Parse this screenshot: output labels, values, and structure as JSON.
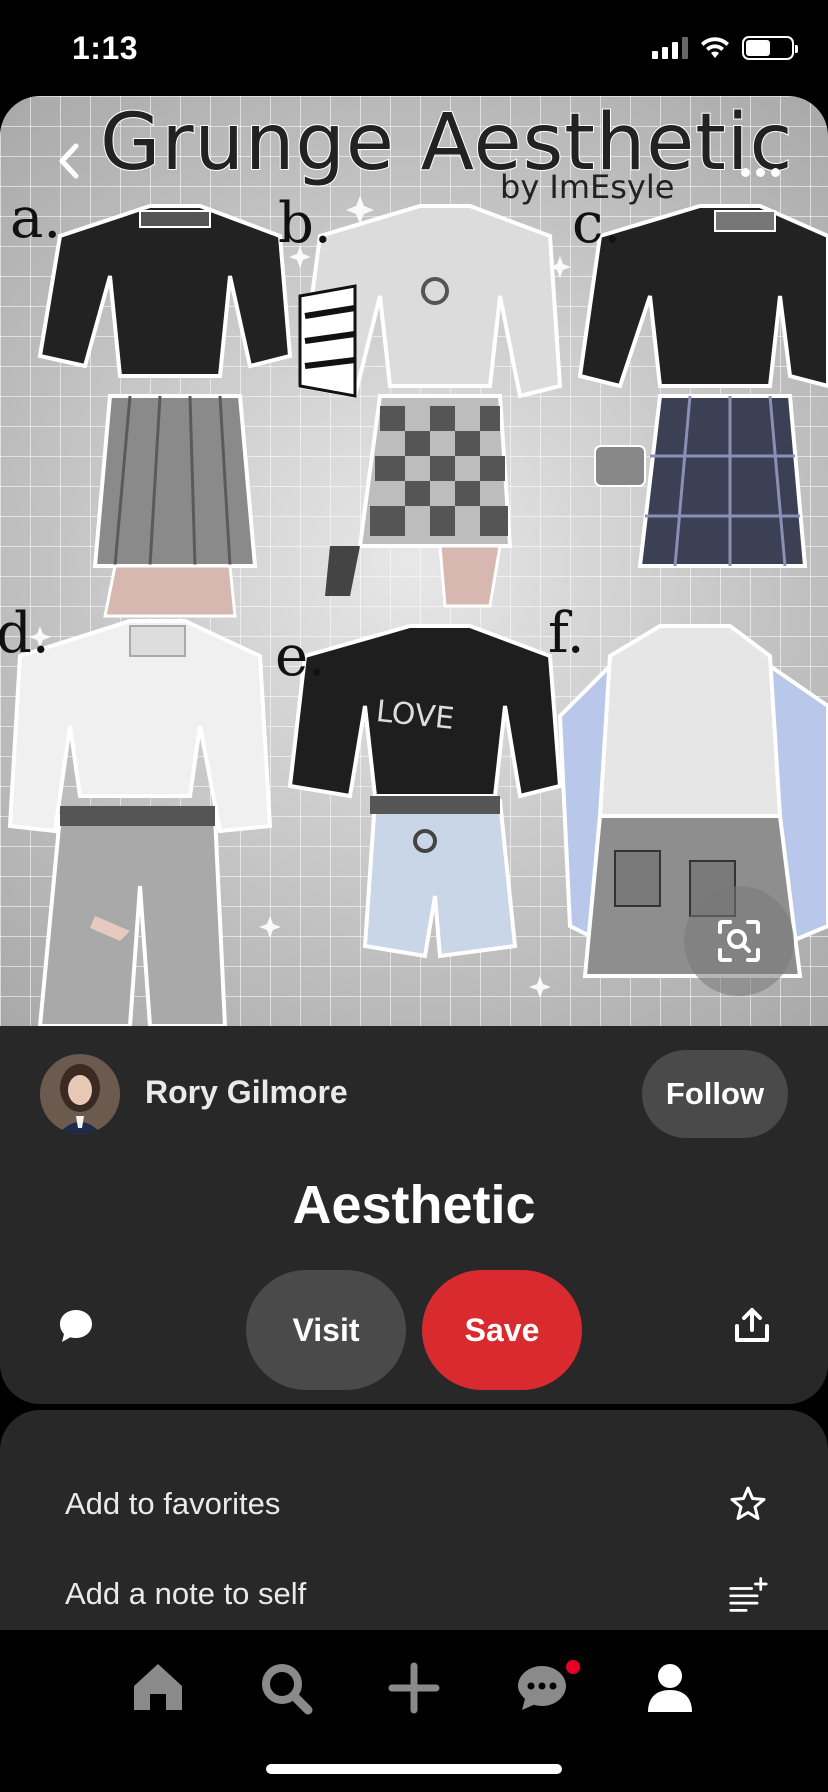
{
  "status_bar": {
    "time": "1:13"
  },
  "pin": {
    "image_title": "Grunge Aesthetic",
    "image_subtitle": "by ImEsyle",
    "outfit_letters": [
      "a.",
      "b.",
      "c.",
      "d.",
      "e.",
      "f."
    ],
    "shirt_text": "LOVE"
  },
  "creator": {
    "name": "Rory Gilmore",
    "follow_label": "Follow"
  },
  "pin_heading": "Aesthetic",
  "actions": {
    "visit_label": "Visit",
    "save_label": "Save"
  },
  "options": [
    {
      "label": "Add to favorites",
      "icon": "star-icon"
    },
    {
      "label": "Add a note to self",
      "icon": "note-list-icon"
    }
  ],
  "tabs": [
    {
      "icon": "home-icon"
    },
    {
      "icon": "search-icon"
    },
    {
      "icon": "plus-icon"
    },
    {
      "icon": "messages-icon",
      "has_notification": true
    },
    {
      "icon": "profile-icon"
    }
  ],
  "colors": {
    "save_red": "#d92b2f",
    "card_bg": "#282828",
    "notification_red": "#e60023"
  }
}
